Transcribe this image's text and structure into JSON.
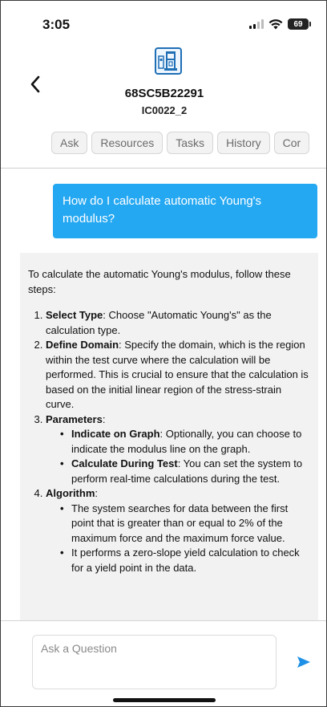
{
  "status_bar": {
    "time": "3:05",
    "battery": "69"
  },
  "header": {
    "title": "68SC5B22291",
    "subtitle": "IC0022_2",
    "tabs": [
      "Ask",
      "Resources",
      "Tasks",
      "History",
      "Cor"
    ]
  },
  "conversation": {
    "user_question": "How do I calculate automatic Young's modulus?",
    "answer": {
      "intro": "To calculate the automatic Young's modulus, follow these steps:",
      "step1_title": "Select Type",
      "step1_text": ": Choose \"Automatic Young's\" as the calculation type.",
      "step2_title": "Define Domain",
      "step2_text": ": Specify the domain, which is the region within the test curve where the calculation will be performed. This is crucial to ensure that the calculation is based on the initial linear region of the stress-strain curve.",
      "step3_title": "Parameters",
      "step3_suffix": ":",
      "step3_sub1_title": "Indicate on Graph",
      "step3_sub1_text": ": Optionally, you can choose to indicate the modulus line on the graph.",
      "step3_sub2_title": "Calculate During Test",
      "step3_sub2_text": ": You can set the system to perform real-time calculations during the test.",
      "step4_title": "Algorithm",
      "step4_suffix": ":",
      "step4_sub1_text": "The system searches for data between the first point that is greater than or equal to 2% of the maximum force and the maximum force value.",
      "step4_sub2_text": "It performs a zero-slope yield calculation to check for a yield point in the data."
    }
  },
  "composer": {
    "placeholder": "Ask a Question"
  },
  "icons": {
    "back": "chevron-left-icon",
    "device": "tensile-tester-icon",
    "send": "send-icon"
  },
  "colors": {
    "user_bubble": "#25a8f2",
    "send": "#1e90e6",
    "assistant_bubble": "#f2f2f2"
  }
}
